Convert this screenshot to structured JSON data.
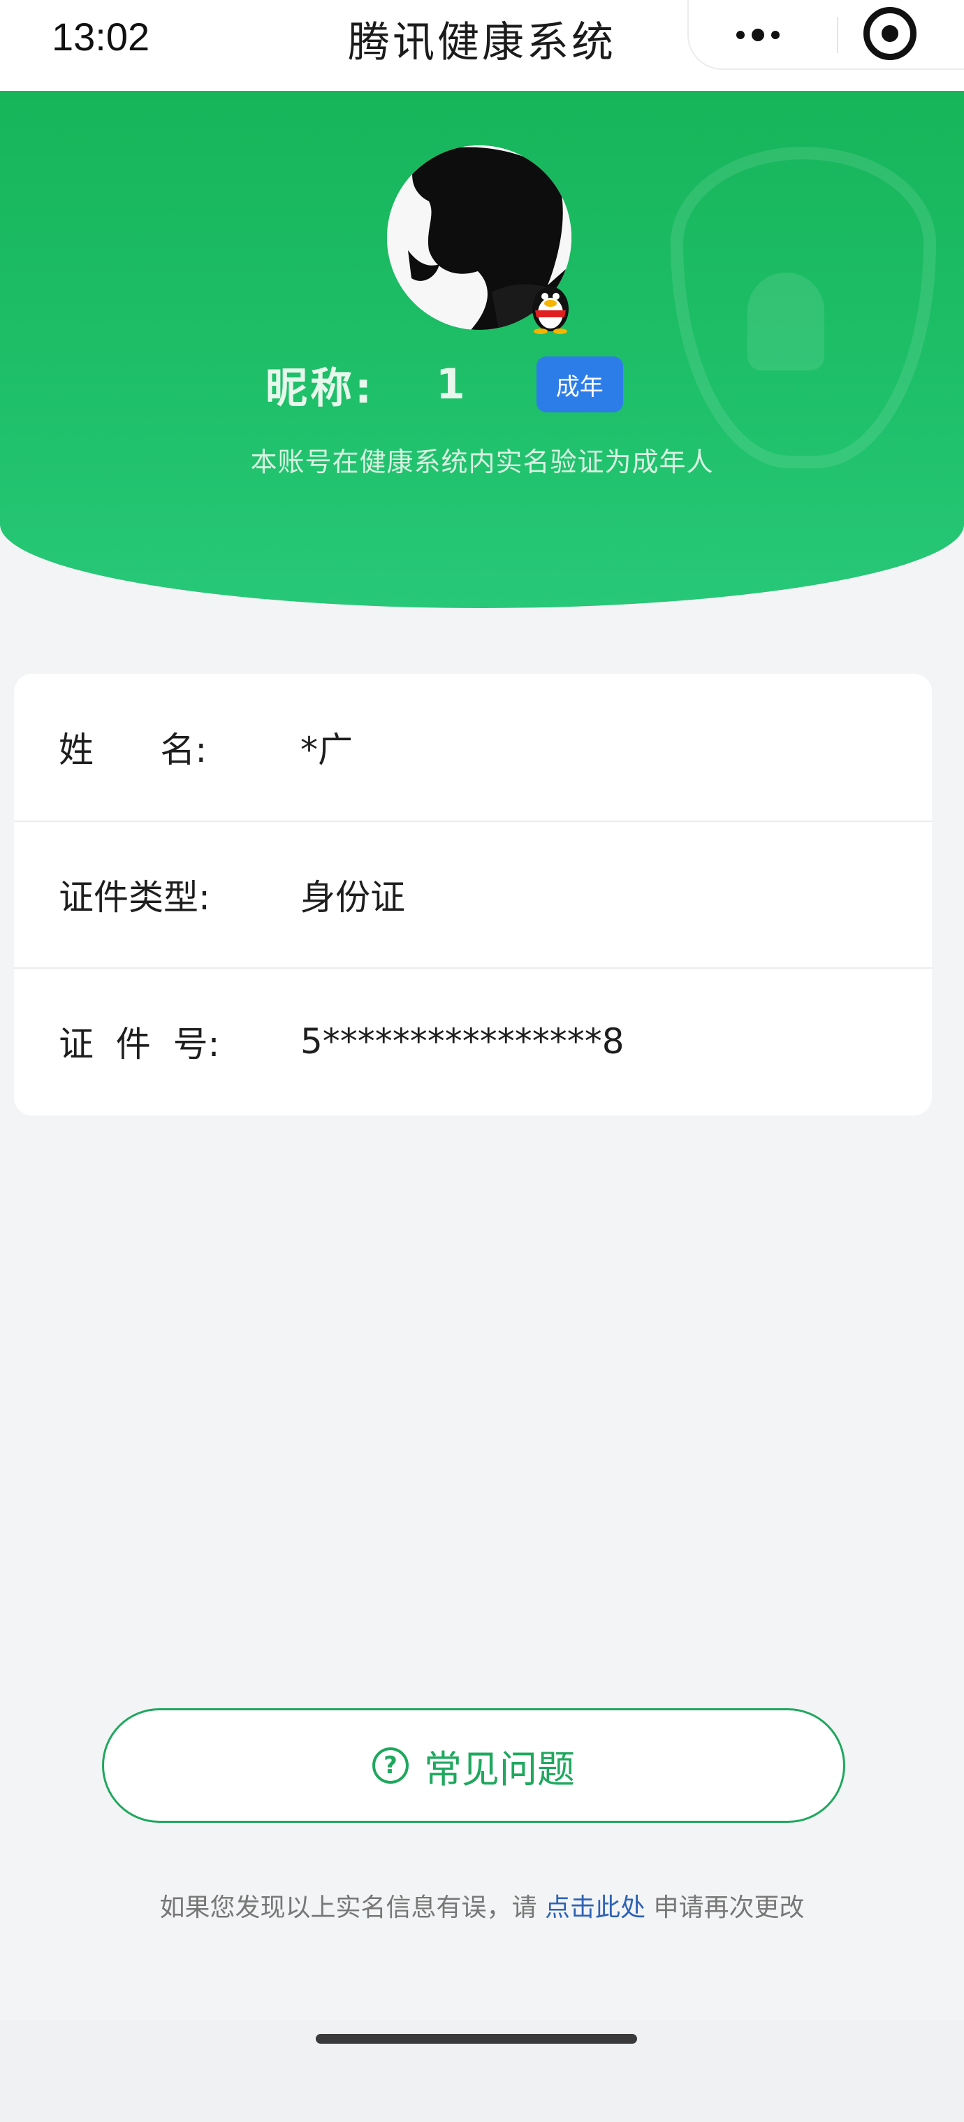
{
  "status_bar": {
    "time": "13:02"
  },
  "nav": {
    "title": "腾讯健康系统",
    "more_icon": "more-dots-icon",
    "close_icon": "target-close-icon"
  },
  "profile": {
    "nickname_label": "昵称:",
    "nickname_value": "1",
    "age_badge": "成年",
    "verify_note": "本账号在健康系统内实名验证为成年人",
    "avatar_icon": "qq-avatar",
    "badge_icon": "qq-penguin-icon"
  },
  "info_rows": [
    {
      "label": "姓      名:",
      "value": "*广"
    },
    {
      "label": "证件类型:",
      "value": "身份证"
    },
    {
      "label": "证  件  号:",
      "value": "5****************8"
    }
  ],
  "faq": {
    "label": "常见问题",
    "icon": "question-circle-icon"
  },
  "fix_note": {
    "prefix": "如果您发现以上实名信息有误，请 ",
    "link": "点击此处",
    "suffix": " 申请再次更改"
  },
  "colors": {
    "green": "#1fc06a",
    "accent_green": "#1fa85e",
    "badge_blue": "#2d7de8",
    "link_blue": "#2d63b8"
  }
}
